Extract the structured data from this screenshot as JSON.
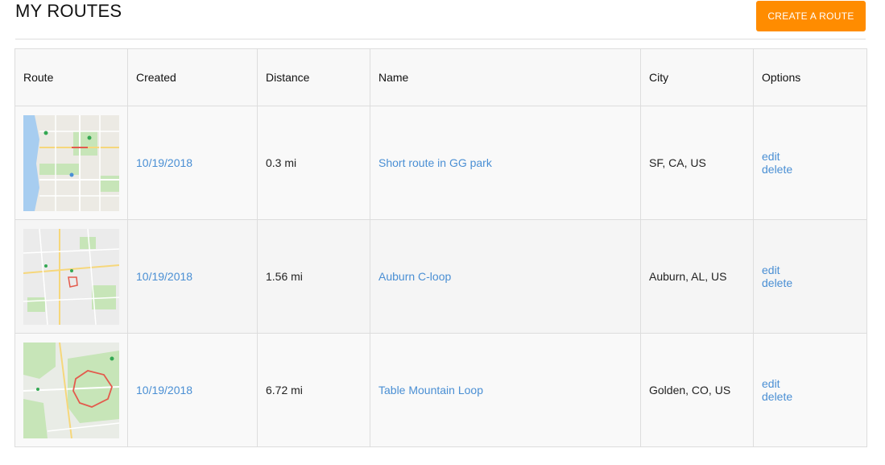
{
  "header": {
    "title": "MY ROUTES",
    "create_label": "CREATE A ROUTE"
  },
  "table": {
    "columns": [
      "Route",
      "Created",
      "Distance",
      "Name",
      "City",
      "Options"
    ],
    "rows": [
      {
        "map": "map-thumbnail-sf",
        "created": "10/19/2018",
        "distance": "0.3 mi",
        "name": "Short route in GG park",
        "city": "SF, CA, US",
        "edit": "edit",
        "delete": "delete"
      },
      {
        "map": "map-thumbnail-auburn",
        "created": "10/19/2018",
        "distance": "1.56 mi",
        "name": "Auburn C-loop",
        "city": "Auburn, AL, US",
        "edit": "edit",
        "delete": "delete"
      },
      {
        "map": "map-thumbnail-golden",
        "created": "10/19/2018",
        "distance": "6.72 mi",
        "name": "Table Mountain Loop",
        "city": "Golden, CO, US",
        "edit": "edit",
        "delete": "delete"
      }
    ]
  },
  "colors": {
    "accent": "#ff8c00",
    "link": "#4a8fd4"
  }
}
